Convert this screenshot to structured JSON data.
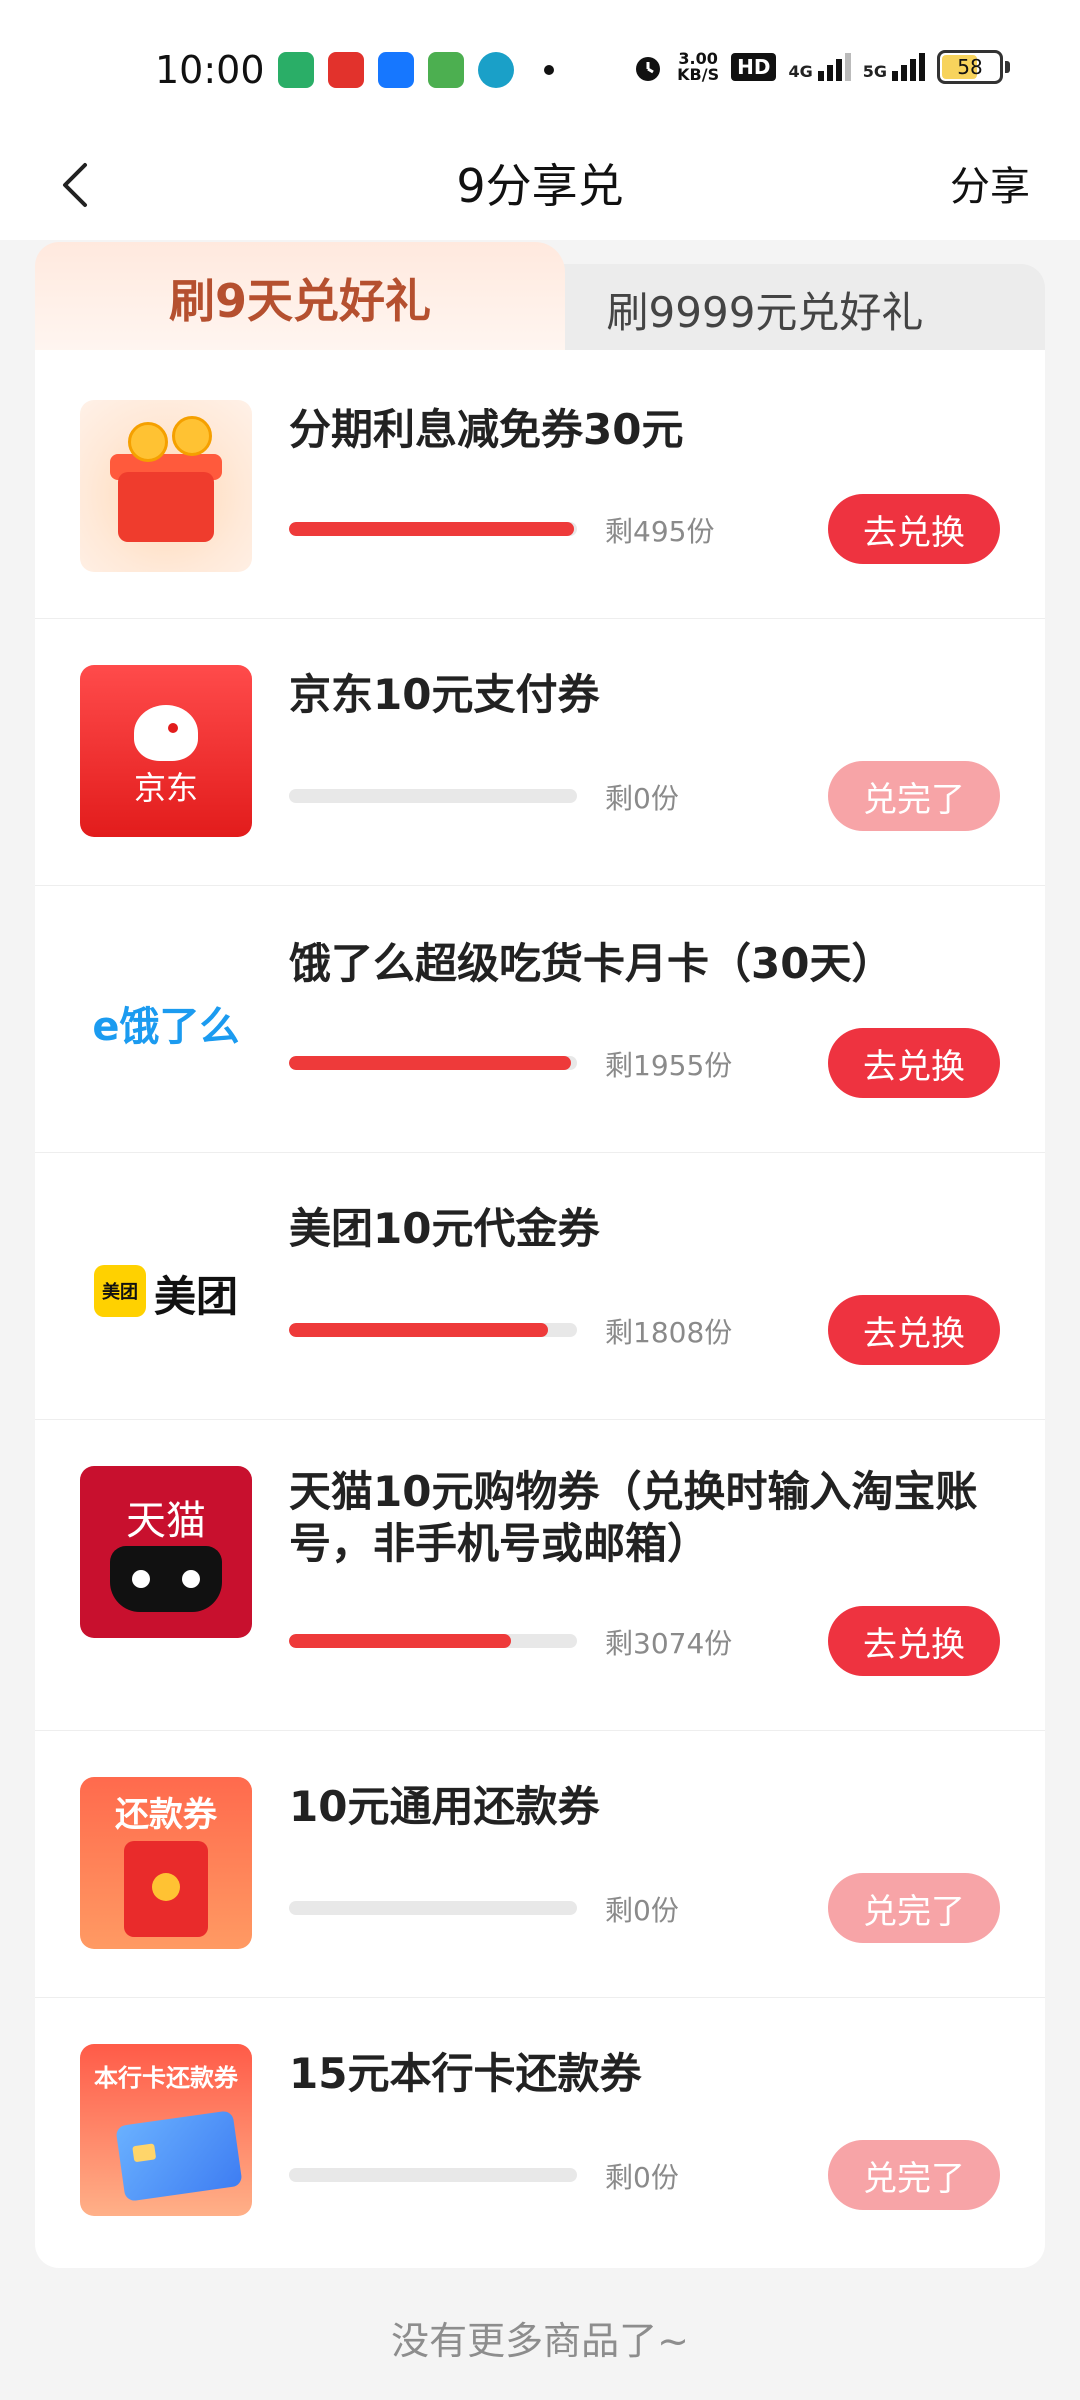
{
  "status_bar": {
    "time": "10:00",
    "net_speed_value": "3.00",
    "net_speed_unit": "KB/S",
    "hd_label": "HD",
    "signal_1_label": "4G",
    "signal_2_label": "5G",
    "battery": "58"
  },
  "header": {
    "title": "9分享兑",
    "share_label": "分享"
  },
  "tabs": [
    {
      "label": "刷9天兑好礼",
      "active": true
    },
    {
      "label": "刷9999元兑好礼",
      "active": false
    }
  ],
  "items": [
    {
      "title": "分期利息减免券30元",
      "remaining": "剩495份",
      "progress": 0.99,
      "button": "去兑换",
      "available": true
    },
    {
      "title": "京东10元支付券",
      "remaining": "剩0份",
      "progress": 0,
      "button": "兑完了",
      "available": false
    },
    {
      "title": "饿了么超级吃货卡月卡（30天）",
      "remaining": "剩1955份",
      "progress": 0.98,
      "button": "去兑换",
      "available": true
    },
    {
      "title": "美团10元代金券",
      "remaining": "剩1808份",
      "progress": 0.9,
      "button": "去兑换",
      "available": true
    },
    {
      "title": "天猫10元购物券（兑换时输入淘宝账号，非手机号或邮箱）",
      "remaining": "剩3074份",
      "progress": 0.77,
      "button": "去兑换",
      "available": true
    },
    {
      "title": "10元通用还款券",
      "remaining": "剩0份",
      "progress": 0,
      "button": "兑完了",
      "available": false
    },
    {
      "title": "15元本行卡还款券",
      "remaining": "剩0份",
      "progress": 0,
      "button": "兑完了",
      "available": false
    }
  ],
  "thumbs": {
    "jd_text": "京东",
    "ele_text": "e饿了么",
    "meituan_badge": "美团",
    "meituan_text": "美团",
    "tmall_text": "天猫",
    "repay_title": "还款券",
    "bank_title": "本行卡还款券"
  },
  "footer": {
    "text": "没有更多商品了~"
  },
  "colors": {
    "accent": "#ee3340",
    "disabled_button": "#f7a4a7",
    "progress_fill": "#ee3a3a",
    "active_tab_text": "#b5502f"
  }
}
